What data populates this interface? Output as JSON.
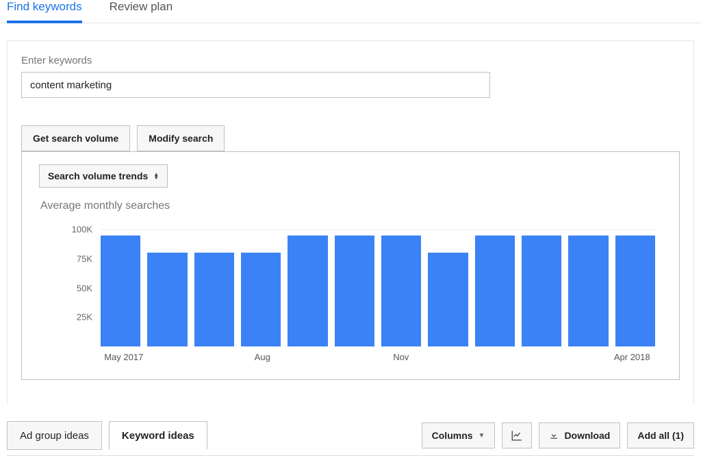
{
  "tabs": {
    "find_keywords": "Find keywords",
    "review_plan": "Review plan"
  },
  "input": {
    "label": "Enter keywords",
    "value": "content marketing"
  },
  "buttons": {
    "get_volume": "Get search volume",
    "modify_search": "Modify search"
  },
  "chart_dropdown": "Search volume trends",
  "chart_title": "Average monthly searches",
  "chart_data": {
    "type": "bar",
    "title": "Average monthly searches",
    "ylabel": "",
    "xlabel": "",
    "ylim": [
      0,
      100000
    ],
    "y_ticks": [
      "100K",
      "75K",
      "50K",
      "25K"
    ],
    "y_tick_values": [
      100000,
      75000,
      50000,
      25000
    ],
    "categories": [
      "May 2017",
      "Jun 2017",
      "Jul 2017",
      "Aug 2017",
      "Sep 2017",
      "Oct 2017",
      "Nov 2017",
      "Dec 2017",
      "Jan 2018",
      "Feb 2018",
      "Mar 2018",
      "Apr 2018"
    ],
    "x_visible_labels": {
      "0": "May 2017",
      "3": "Aug",
      "6": "Nov",
      "11": "Apr 2018"
    },
    "values": [
      95000,
      80000,
      80000,
      80000,
      95000,
      95000,
      95000,
      80000,
      95000,
      95000,
      95000,
      95000
    ]
  },
  "bottom": {
    "ad_group_ideas": "Ad group ideas",
    "keyword_ideas": "Keyword ideas",
    "columns": "Columns",
    "download": "Download",
    "add_all": "Add all (1)"
  }
}
